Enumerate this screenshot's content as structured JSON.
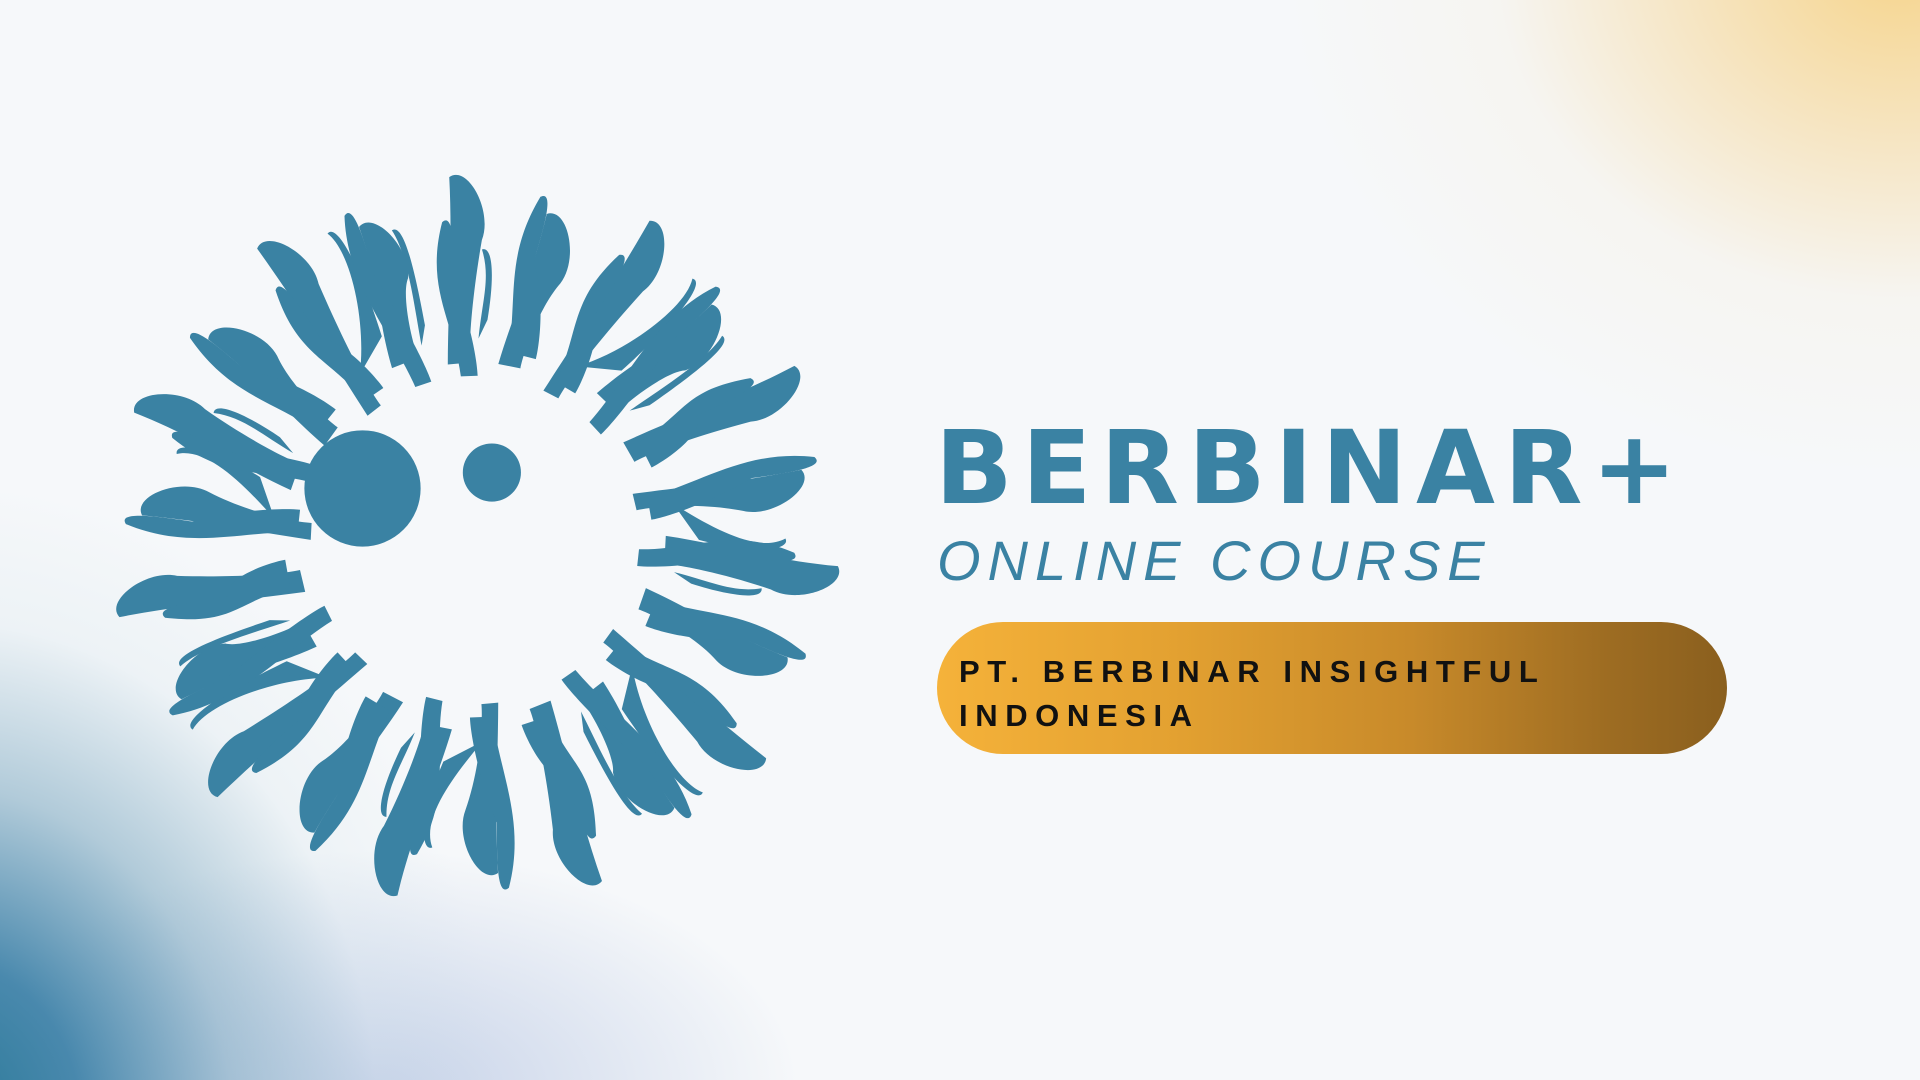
{
  "brand": {
    "title": "BERBINAR+",
    "subtitle": "ONLINE COURSE"
  },
  "company": {
    "name": "PT. BERBINAR INSIGHTFUL INDONESIA"
  },
  "logo": {
    "icon": "sunburst-logo-icon",
    "color": "#3a82a3"
  },
  "colors": {
    "primary": "#3a82a3",
    "pill_gradient_start": "#f5b23a",
    "pill_gradient_end": "#8a5f1e",
    "company_text": "#111111",
    "background": "#f6f8fa"
  }
}
